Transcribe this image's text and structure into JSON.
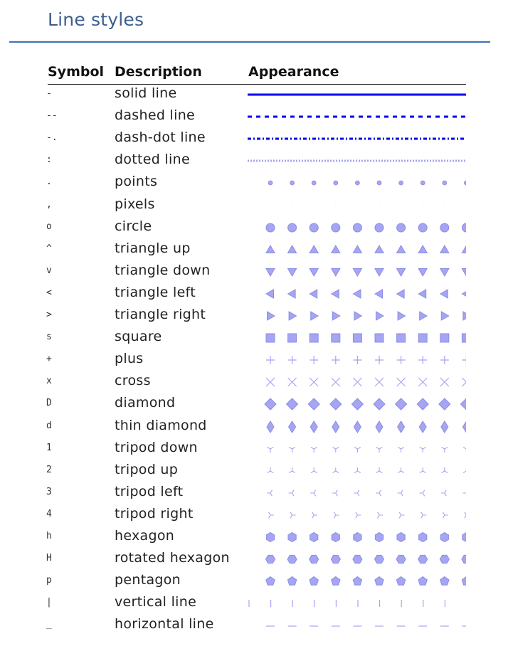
{
  "page": {
    "title": "Line styles"
  },
  "table": {
    "headers": {
      "symbol": "Symbol",
      "description": "Description",
      "appearance": "Appearance"
    },
    "rows": [
      {
        "symbol": "-",
        "description": "solid line",
        "style": "solid"
      },
      {
        "symbol": "--",
        "description": "dashed line",
        "style": "dashed"
      },
      {
        "symbol": "-.",
        "description": "dash-dot line",
        "style": "dashdot"
      },
      {
        "symbol": ":",
        "description": "dotted line",
        "style": "dotted"
      },
      {
        "symbol": ".",
        "description": "points",
        "style": "point"
      },
      {
        "symbol": ",",
        "description": "pixels",
        "style": "pixel"
      },
      {
        "symbol": "o",
        "description": "circle",
        "style": "circle"
      },
      {
        "symbol": "^",
        "description": "triangle up",
        "style": "tri-up"
      },
      {
        "symbol": "v",
        "description": "triangle down",
        "style": "tri-down"
      },
      {
        "symbol": "<",
        "description": "triangle left",
        "style": "tri-left"
      },
      {
        "symbol": ">",
        "description": "triangle right",
        "style": "tri-right"
      },
      {
        "symbol": "s",
        "description": "square",
        "style": "square"
      },
      {
        "symbol": "+",
        "description": "plus",
        "style": "plus"
      },
      {
        "symbol": "x",
        "description": "cross",
        "style": "cross"
      },
      {
        "symbol": "D",
        "description": "diamond",
        "style": "diamond"
      },
      {
        "symbol": "d",
        "description": "thin diamond",
        "style": "thin-diamond"
      },
      {
        "symbol": "1",
        "description": "tripod down",
        "style": "tripod-down"
      },
      {
        "symbol": "2",
        "description": "tripod up",
        "style": "tripod-up"
      },
      {
        "symbol": "3",
        "description": "tripod left",
        "style": "tripod-left"
      },
      {
        "symbol": "4",
        "description": "tripod right",
        "style": "tripod-right"
      },
      {
        "symbol": "h",
        "description": "hexagon",
        "style": "hexagon"
      },
      {
        "symbol": "H",
        "description": "rotated hexagon",
        "style": "hexagon-rot"
      },
      {
        "symbol": "p",
        "description": "pentagon",
        "style": "pentagon"
      },
      {
        "symbol": "|",
        "description": "vertical line",
        "style": "vline"
      },
      {
        "symbol": "_",
        "description": "horizontal line",
        "style": "hline"
      }
    ]
  },
  "colors": {
    "title": "#3b5f8e",
    "rule": "#3b73b0",
    "line": "#0000ee",
    "marker_fill": "#a5a5f2",
    "marker_edge": "#8c8ce8"
  }
}
